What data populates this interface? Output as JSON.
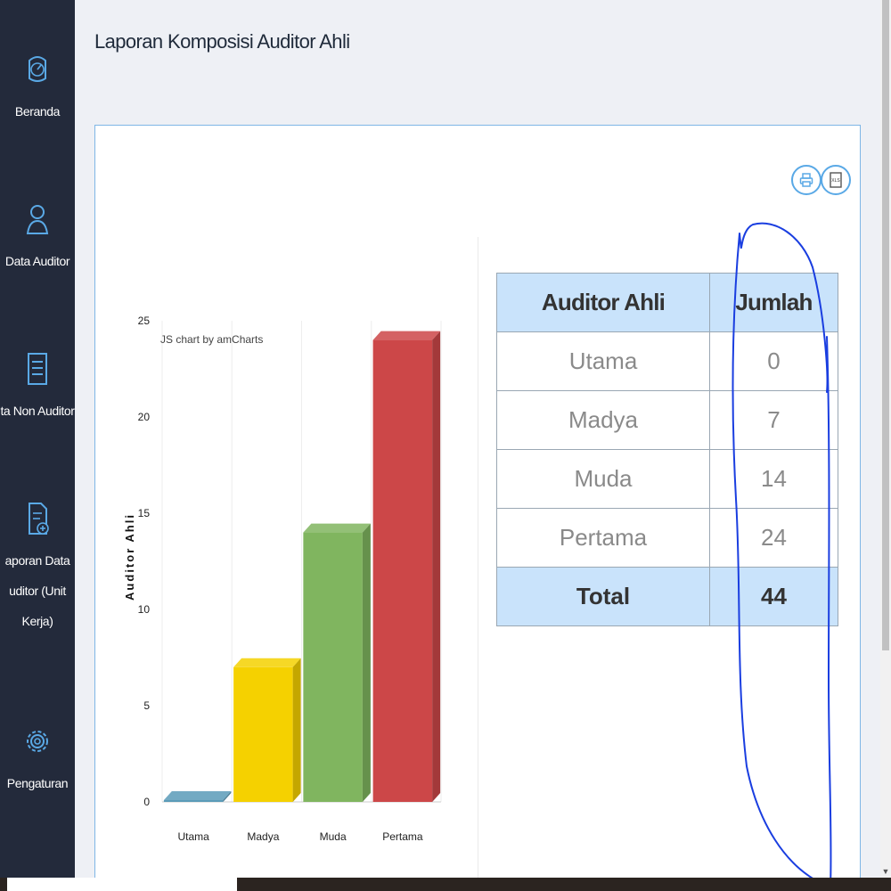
{
  "sidebar": {
    "items": [
      {
        "label": "Beranda",
        "icon": "speedometer-icon"
      },
      {
        "label": "Data Auditor",
        "icon": "user-outline-icon"
      },
      {
        "label": "ta Non Auditor",
        "icon": "checklist-icon"
      },
      {
        "label_lines": [
          "aporan Data",
          "uditor (Unit",
          "Kerja)"
        ],
        "icon": "report-add-icon"
      },
      {
        "label": "Pengaturan",
        "icon": "gear-icon"
      }
    ]
  },
  "page": {
    "title": "Laporan Komposisi Auditor Ahli"
  },
  "toolbar": {
    "print_icon": "printer-icon",
    "export_icon": "xls-export-icon",
    "export_text": "XLS"
  },
  "table": {
    "headers": [
      "Auditor Ahli",
      "Jumlah"
    ],
    "rows": [
      {
        "label": "Utama",
        "value": "0"
      },
      {
        "label": "Madya",
        "value": "7"
      },
      {
        "label": "Muda",
        "value": "14"
      },
      {
        "label": "Pertama",
        "value": "24"
      }
    ],
    "total": {
      "label": "Total",
      "value": "44"
    }
  },
  "chart_data": {
    "type": "bar",
    "categories": [
      "Utama",
      "Madya",
      "Muda",
      "Pertama"
    ],
    "values": [
      0,
      7,
      14,
      24
    ],
    "colors": [
      "#5b9bb8",
      "#f5d100",
      "#80b55f",
      "#cc4748"
    ],
    "ylabel": "Auditor Ahli",
    "yticks": [
      0,
      5,
      10,
      15,
      20,
      25
    ],
    "ylim": [
      0,
      25
    ],
    "credit": "JS chart by amCharts",
    "grid": true
  },
  "colors": {
    "sidebar_bg": "#232a3b",
    "header_bg": "#c9e3fb",
    "accent": "#5aa9e6",
    "annotation": "#1a3ee0"
  }
}
